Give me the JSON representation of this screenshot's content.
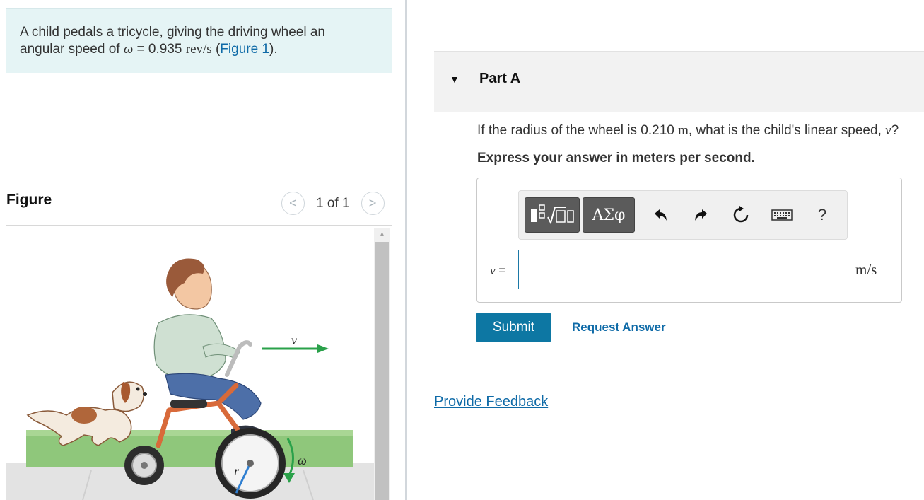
{
  "intro": {
    "line1": "A child pedals a tricycle, giving the driving wheel an",
    "line2_prefix": "angular speed of ",
    "omega": "ω",
    "equals": " = 0.935 ",
    "unit": "rev/s",
    "open_paren": " (",
    "figure_link": "Figure 1",
    "close_paren": ")."
  },
  "figure": {
    "title": "Figure",
    "prev": "<",
    "next": ">",
    "count": "1 of 1",
    "label_v": "v",
    "label_omega": "ω",
    "label_r": "r"
  },
  "part": {
    "toggle": "▼",
    "title": "Part A",
    "question_prefix": "If the radius of the wheel is 0.210 ",
    "question_unit": "m",
    "question_mid": ", what is the child's linear speed, ",
    "question_var": "v",
    "question_suffix": "?",
    "instruction": "Express your answer in meters per second."
  },
  "answer": {
    "toolbar": {
      "greek_label": "ΑΣφ",
      "help_label": "?"
    },
    "var_label": "v",
    "equals": " =",
    "input_value": "",
    "unit": "m/s"
  },
  "actions": {
    "submit_label": "Submit",
    "request_answer_label": "Request Answer",
    "feedback_label": "Provide Feedback"
  },
  "colors": {
    "accent": "#0d77a3",
    "link": "#0e6aa7",
    "intro_bg": "#e5f4f5",
    "arrow_green": "#2aa14a"
  }
}
